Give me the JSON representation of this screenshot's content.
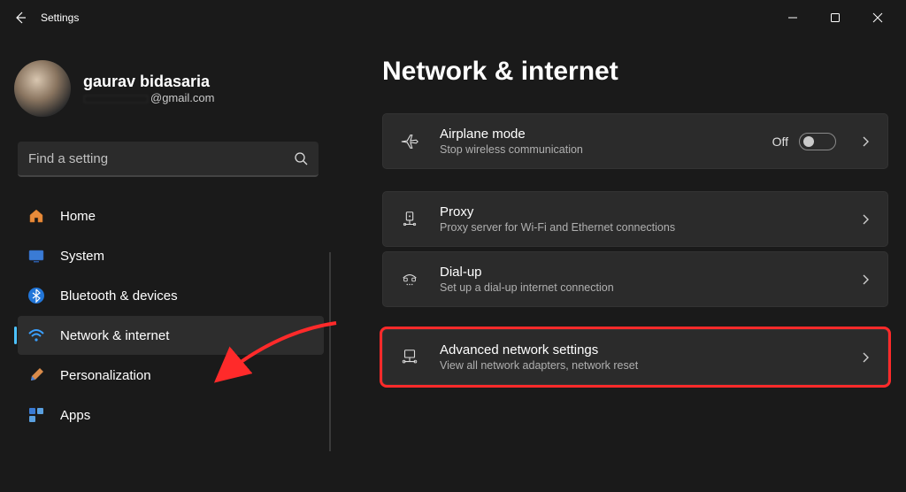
{
  "window": {
    "app_title": "Settings"
  },
  "profile": {
    "name": "gaurav bidasaria",
    "email_suffix": "@gmail.com"
  },
  "search": {
    "placeholder": "Find a setting"
  },
  "nav": {
    "items": [
      {
        "label": "Home"
      },
      {
        "label": "System"
      },
      {
        "label": "Bluetooth & devices"
      },
      {
        "label": "Network & internet"
      },
      {
        "label": "Personalization"
      },
      {
        "label": "Apps"
      }
    ]
  },
  "main": {
    "title": "Network & internet",
    "cards": [
      {
        "title": "Airplane mode",
        "sub": "Stop wireless communication",
        "toggle_label": "Off"
      },
      {
        "title": "Proxy",
        "sub": "Proxy server for Wi-Fi and Ethernet connections"
      },
      {
        "title": "Dial-up",
        "sub": "Set up a dial-up internet connection"
      },
      {
        "title": "Advanced network settings",
        "sub": "View all network adapters, network reset"
      }
    ]
  }
}
